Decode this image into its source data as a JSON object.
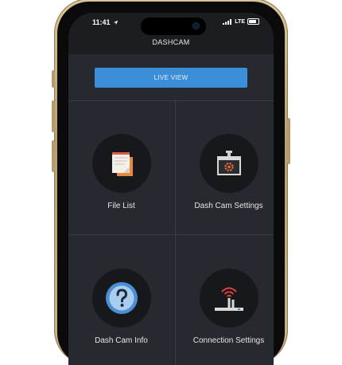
{
  "status_bar": {
    "time": "11:41",
    "network": "LTE"
  },
  "nav": {
    "title": "DASHCAM"
  },
  "live_view": {
    "label": "LIVE VIEW"
  },
  "tiles": [
    {
      "label": "File List",
      "icon": "file-list-icon"
    },
    {
      "label": "Dash Cam Settings",
      "icon": "dashcam-settings-icon"
    },
    {
      "label": "Dash Cam Info",
      "icon": "question-icon"
    },
    {
      "label": "Connection Settings",
      "icon": "router-icon"
    }
  ],
  "colors": {
    "accent": "#3d8ed8",
    "background": "#26292f",
    "icon_circle": "#16181c"
  }
}
